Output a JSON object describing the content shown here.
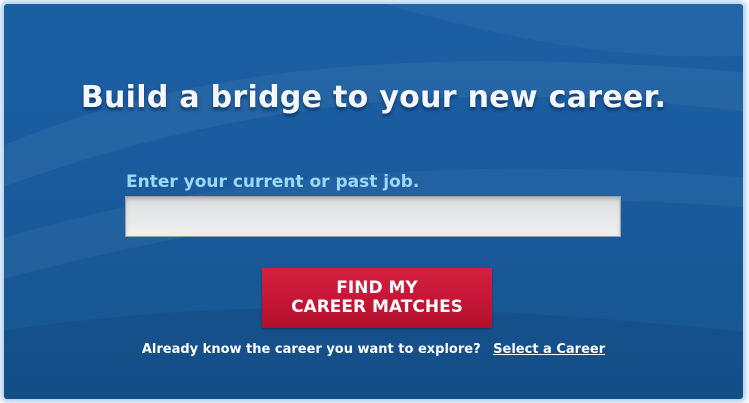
{
  "hero": {
    "headline": "Build a bridge to your new career."
  },
  "search": {
    "label": "Enter your current or past job.",
    "value": "",
    "placeholder": ""
  },
  "cta": {
    "line1": "FIND MY",
    "line2": "CAREER MATCHES"
  },
  "explore": {
    "prompt": "Already know the career you want to explore?",
    "link_label": "Select a Career"
  },
  "colors": {
    "panel_blue": "#1a5b9e",
    "label_cyan": "#9ed8f6",
    "button_red": "#c51535",
    "frame_glow": "#8cb9e6"
  }
}
